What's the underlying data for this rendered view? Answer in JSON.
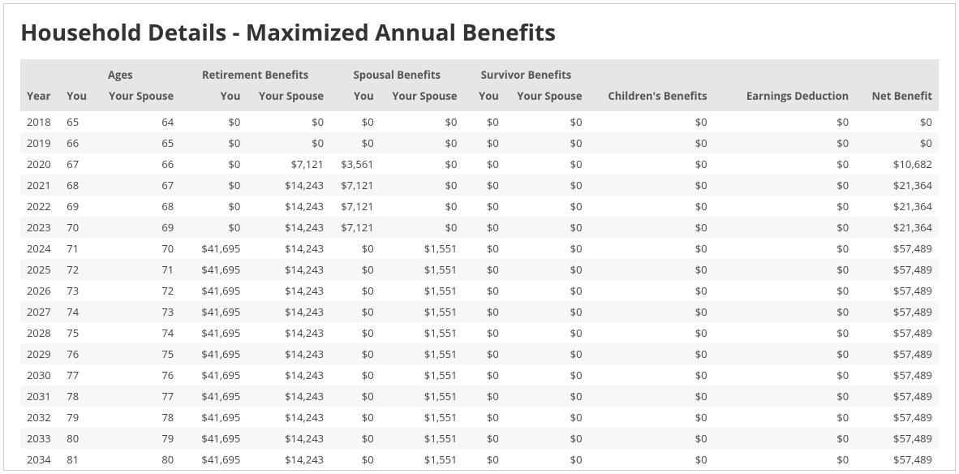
{
  "title": "Household Details - Maximized Annual Benefits",
  "headers": {
    "groups": {
      "ages": "Ages",
      "retirement": "Retirement Benefits",
      "spousal": "Spousal Benefits",
      "survivor": "Survivor Benefits"
    },
    "cols": {
      "year": "Year",
      "you": "You",
      "your_spouse": "Your Spouse",
      "childrens_benefits": "Children's Benefits",
      "earnings_deduction": "Earnings Deduction",
      "net_benefit": "Net Benefit"
    }
  },
  "rows": [
    {
      "year": "2018",
      "age_you": "65",
      "age_spouse": "64",
      "ret_you": "$0",
      "ret_spouse": "$0",
      "sp_you": "$0",
      "sp_spouse": "$0",
      "sv_you": "$0",
      "sv_spouse": "$0",
      "children": "$0",
      "earn_ded": "$0",
      "net": "$0"
    },
    {
      "year": "2019",
      "age_you": "66",
      "age_spouse": "65",
      "ret_you": "$0",
      "ret_spouse": "$0",
      "sp_you": "$0",
      "sp_spouse": "$0",
      "sv_you": "$0",
      "sv_spouse": "$0",
      "children": "$0",
      "earn_ded": "$0",
      "net": "$0"
    },
    {
      "year": "2020",
      "age_you": "67",
      "age_spouse": "66",
      "ret_you": "$0",
      "ret_spouse": "$7,121",
      "sp_you": "$3,561",
      "sp_spouse": "$0",
      "sv_you": "$0",
      "sv_spouse": "$0",
      "children": "$0",
      "earn_ded": "$0",
      "net": "$10,682"
    },
    {
      "year": "2021",
      "age_you": "68",
      "age_spouse": "67",
      "ret_you": "$0",
      "ret_spouse": "$14,243",
      "sp_you": "$7,121",
      "sp_spouse": "$0",
      "sv_you": "$0",
      "sv_spouse": "$0",
      "children": "$0",
      "earn_ded": "$0",
      "net": "$21,364"
    },
    {
      "year": "2022",
      "age_you": "69",
      "age_spouse": "68",
      "ret_you": "$0",
      "ret_spouse": "$14,243",
      "sp_you": "$7,121",
      "sp_spouse": "$0",
      "sv_you": "$0",
      "sv_spouse": "$0",
      "children": "$0",
      "earn_ded": "$0",
      "net": "$21,364"
    },
    {
      "year": "2023",
      "age_you": "70",
      "age_spouse": "69",
      "ret_you": "$0",
      "ret_spouse": "$14,243",
      "sp_you": "$7,121",
      "sp_spouse": "$0",
      "sv_you": "$0",
      "sv_spouse": "$0",
      "children": "$0",
      "earn_ded": "$0",
      "net": "$21,364"
    },
    {
      "year": "2024",
      "age_you": "71",
      "age_spouse": "70",
      "ret_you": "$41,695",
      "ret_spouse": "$14,243",
      "sp_you": "$0",
      "sp_spouse": "$1,551",
      "sv_you": "$0",
      "sv_spouse": "$0",
      "children": "$0",
      "earn_ded": "$0",
      "net": "$57,489"
    },
    {
      "year": "2025",
      "age_you": "72",
      "age_spouse": "71",
      "ret_you": "$41,695",
      "ret_spouse": "$14,243",
      "sp_you": "$0",
      "sp_spouse": "$1,551",
      "sv_you": "$0",
      "sv_spouse": "$0",
      "children": "$0",
      "earn_ded": "$0",
      "net": "$57,489"
    },
    {
      "year": "2026",
      "age_you": "73",
      "age_spouse": "72",
      "ret_you": "$41,695",
      "ret_spouse": "$14,243",
      "sp_you": "$0",
      "sp_spouse": "$1,551",
      "sv_you": "$0",
      "sv_spouse": "$0",
      "children": "$0",
      "earn_ded": "$0",
      "net": "$57,489"
    },
    {
      "year": "2027",
      "age_you": "74",
      "age_spouse": "73",
      "ret_you": "$41,695",
      "ret_spouse": "$14,243",
      "sp_you": "$0",
      "sp_spouse": "$1,551",
      "sv_you": "$0",
      "sv_spouse": "$0",
      "children": "$0",
      "earn_ded": "$0",
      "net": "$57,489"
    },
    {
      "year": "2028",
      "age_you": "75",
      "age_spouse": "74",
      "ret_you": "$41,695",
      "ret_spouse": "$14,243",
      "sp_you": "$0",
      "sp_spouse": "$1,551",
      "sv_you": "$0",
      "sv_spouse": "$0",
      "children": "$0",
      "earn_ded": "$0",
      "net": "$57,489"
    },
    {
      "year": "2029",
      "age_you": "76",
      "age_spouse": "75",
      "ret_you": "$41,695",
      "ret_spouse": "$14,243",
      "sp_you": "$0",
      "sp_spouse": "$1,551",
      "sv_you": "$0",
      "sv_spouse": "$0",
      "children": "$0",
      "earn_ded": "$0",
      "net": "$57,489"
    },
    {
      "year": "2030",
      "age_you": "77",
      "age_spouse": "76",
      "ret_you": "$41,695",
      "ret_spouse": "$14,243",
      "sp_you": "$0",
      "sp_spouse": "$1,551",
      "sv_you": "$0",
      "sv_spouse": "$0",
      "children": "$0",
      "earn_ded": "$0",
      "net": "$57,489"
    },
    {
      "year": "2031",
      "age_you": "78",
      "age_spouse": "77",
      "ret_you": "$41,695",
      "ret_spouse": "$14,243",
      "sp_you": "$0",
      "sp_spouse": "$1,551",
      "sv_you": "$0",
      "sv_spouse": "$0",
      "children": "$0",
      "earn_ded": "$0",
      "net": "$57,489"
    },
    {
      "year": "2032",
      "age_you": "79",
      "age_spouse": "78",
      "ret_you": "$41,695",
      "ret_spouse": "$14,243",
      "sp_you": "$0",
      "sp_spouse": "$1,551",
      "sv_you": "$0",
      "sv_spouse": "$0",
      "children": "$0",
      "earn_ded": "$0",
      "net": "$57,489"
    },
    {
      "year": "2033",
      "age_you": "80",
      "age_spouse": "79",
      "ret_you": "$41,695",
      "ret_spouse": "$14,243",
      "sp_you": "$0",
      "sp_spouse": "$1,551",
      "sv_you": "$0",
      "sv_spouse": "$0",
      "children": "$0",
      "earn_ded": "$0",
      "net": "$57,489"
    },
    {
      "year": "2034",
      "age_you": "81",
      "age_spouse": "80",
      "ret_you": "$41,695",
      "ret_spouse": "$14,243",
      "sp_you": "$0",
      "sp_spouse": "$1,551",
      "sv_you": "$0",
      "sv_spouse": "$0",
      "children": "$0",
      "earn_ded": "$0",
      "net": "$57,489"
    }
  ]
}
